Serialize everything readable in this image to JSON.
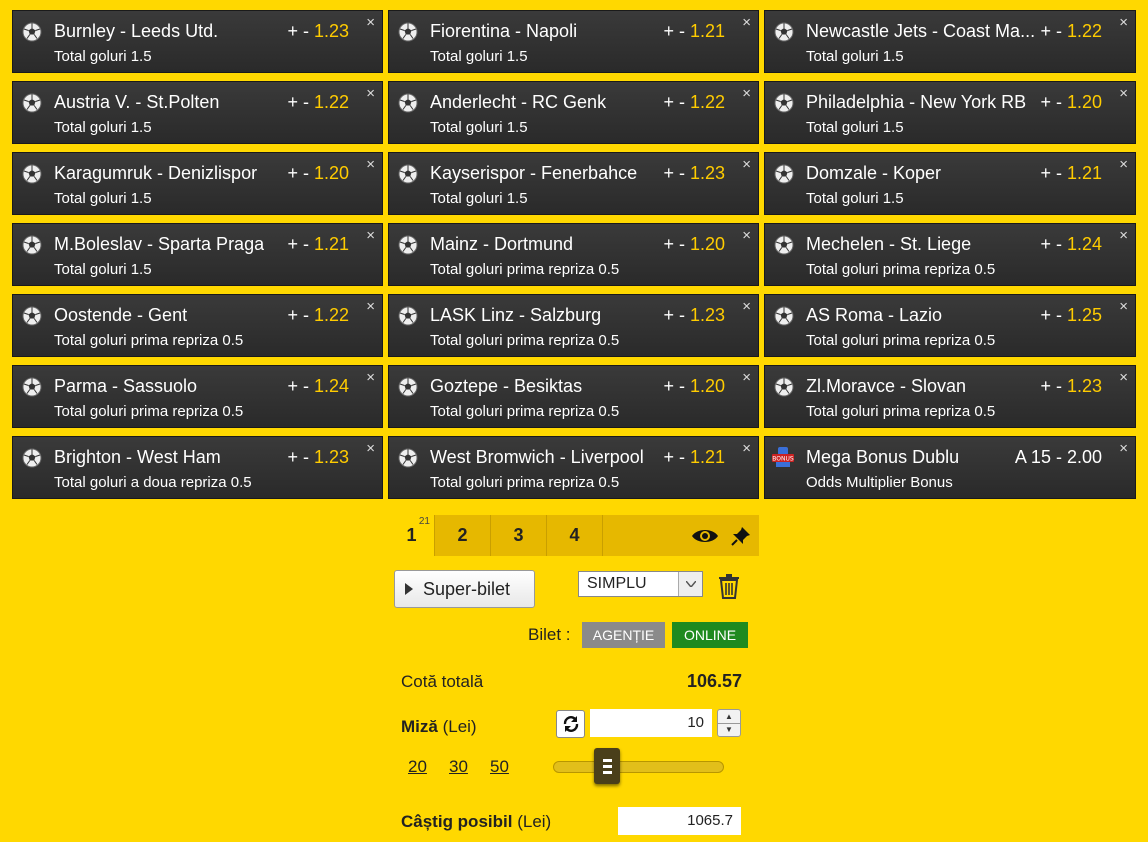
{
  "bets": [
    {
      "match": "Burnley - Leeds Utd.",
      "market": "Total goluri 1.5",
      "odds_prefix": "+ - ",
      "odds": "1.23"
    },
    {
      "match": "Fiorentina - Napoli",
      "market": "Total goluri 1.5",
      "odds_prefix": "+ - ",
      "odds": "1.21"
    },
    {
      "match": "Newcastle Jets - Coast Ma...",
      "market": "Total goluri 1.5",
      "odds_prefix": "+ - ",
      "odds": "1.22"
    },
    {
      "match": "Austria V. - St.Polten",
      "market": "Total goluri 1.5",
      "odds_prefix": "+ - ",
      "odds": "1.22"
    },
    {
      "match": "Anderlecht - RC Genk",
      "market": "Total goluri 1.5",
      "odds_prefix": "+ - ",
      "odds": "1.22"
    },
    {
      "match": "Philadelphia - New York RB",
      "market": "Total goluri 1.5",
      "odds_prefix": "+ - ",
      "odds": "1.20"
    },
    {
      "match": "Karagumruk - Denizlispor",
      "market": "Total goluri 1.5",
      "odds_prefix": "+ - ",
      "odds": "1.20"
    },
    {
      "match": "Kayserispor - Fenerbahce",
      "market": "Total goluri 1.5",
      "odds_prefix": "+ - ",
      "odds": "1.23"
    },
    {
      "match": "Domzale - Koper",
      "market": "Total goluri 1.5",
      "odds_prefix": "+ - ",
      "odds": "1.21"
    },
    {
      "match": "M.Boleslav - Sparta Praga",
      "market": "Total goluri 1.5",
      "odds_prefix": "+ - ",
      "odds": "1.21"
    },
    {
      "match": "Mainz - Dortmund",
      "market": "Total goluri prima repriza 0.5",
      "odds_prefix": "+ - ",
      "odds": "1.20"
    },
    {
      "match": "Mechelen - St. Liege",
      "market": "Total goluri prima repriza 0.5",
      "odds_prefix": "+ - ",
      "odds": "1.24"
    },
    {
      "match": "Oostende - Gent",
      "market": "Total goluri prima repriza 0.5",
      "odds_prefix": "+ - ",
      "odds": "1.22"
    },
    {
      "match": "LASK Linz - Salzburg",
      "market": "Total goluri prima repriza 0.5",
      "odds_prefix": "+ - ",
      "odds": "1.23"
    },
    {
      "match": "AS Roma - Lazio",
      "market": "Total goluri prima repriza 0.5",
      "odds_prefix": "+ - ",
      "odds": "1.25"
    },
    {
      "match": "Parma - Sassuolo",
      "market": "Total goluri prima repriza 0.5",
      "odds_prefix": "+ - ",
      "odds": "1.24"
    },
    {
      "match": "Goztepe - Besiktas",
      "market": "Total goluri prima repriza 0.5",
      "odds_prefix": "+ - ",
      "odds": "1.20"
    },
    {
      "match": "Zl.Moravce - Slovan",
      "market": "Total goluri prima repriza 0.5",
      "odds_prefix": "+ - ",
      "odds": "1.23"
    },
    {
      "match": "Brighton - West Ham",
      "market": "Total goluri a doua repriza 0.5",
      "odds_prefix": "+ - ",
      "odds": "1.23"
    },
    {
      "match": "West Bromwich - Liverpool",
      "market": "Total goluri prima repriza 0.5",
      "odds_prefix": "+ - ",
      "odds": "1.21"
    }
  ],
  "bonus": {
    "match": "Mega Bonus Dublu",
    "market": "Odds Multiplier Bonus",
    "odds": "A 15 - 2.00",
    "icon_text": "BONUS"
  },
  "close_glyph": "×",
  "tabs": [
    {
      "label": "1",
      "badge": "21"
    },
    {
      "label": "2"
    },
    {
      "label": "3"
    },
    {
      "label": "4"
    }
  ],
  "superbilet_label": "Super-bilet",
  "ticket_type": "SIMPLU",
  "bilet_label": "Bilet :",
  "agentie_label": "AGENȚIE",
  "online_label": "ONLINE",
  "cota_label": "Cotă totală",
  "cota_value": "106.57",
  "miza_label": "Miză",
  "miza_unit": "(Lei)",
  "miza_value": "10",
  "quick_stakes": [
    "20",
    "30",
    "50"
  ],
  "castig_label": "Câștig posibil",
  "castig_unit": "(Lei)",
  "castig_value": "1065.7",
  "colors": {
    "background": "#ffd800",
    "card": "#2f2f2f",
    "odds": "#ffcc00",
    "online": "#1f8a1f",
    "agentie": "#8a8a8a"
  }
}
